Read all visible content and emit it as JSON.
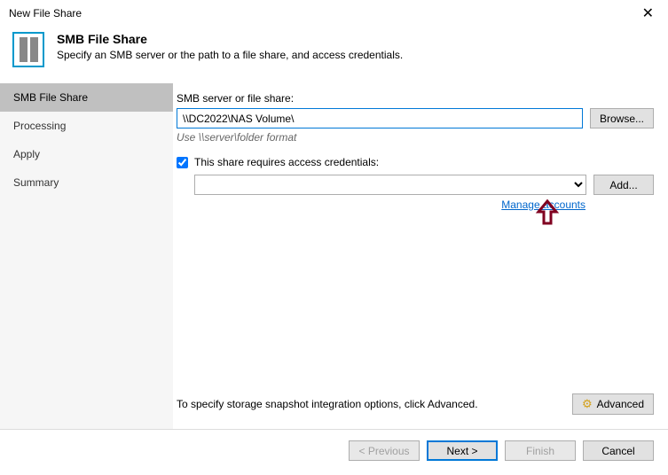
{
  "window": {
    "title": "New File Share"
  },
  "header": {
    "title": "SMB File Share",
    "subtitle": "Specify an SMB server or the path to a file share, and access credentials."
  },
  "sidebar": {
    "items": [
      {
        "label": "SMB File Share",
        "active": true
      },
      {
        "label": "Processing",
        "active": false
      },
      {
        "label": "Apply",
        "active": false
      },
      {
        "label": "Summary",
        "active": false
      }
    ]
  },
  "form": {
    "server_label": "SMB server or file share:",
    "server_value": "\\\\DC2022\\NAS Volume\\",
    "browse_label": "Browse...",
    "hint": "Use \\\\server\\folder format",
    "checkbox_label": "This share requires access credentials:",
    "checkbox_checked": true,
    "credentials_value": "",
    "add_label": "Add...",
    "manage_link": "Manage accounts",
    "bottom_hint": "To specify storage snapshot integration options, click Advanced.",
    "advanced_label": "Advanced"
  },
  "footer": {
    "previous": "< Previous",
    "next": "Next >",
    "finish": "Finish",
    "cancel": "Cancel"
  }
}
